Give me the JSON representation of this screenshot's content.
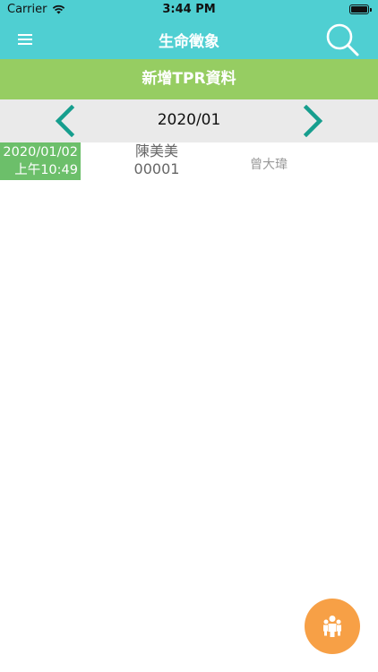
{
  "status_bar": {
    "carrier": "Carrier",
    "time": "3:44 PM",
    "icons": [
      "wifi-icon",
      "battery-icon"
    ]
  },
  "nav": {
    "title": "生命徵象",
    "menu_icon": "hamburger-menu-icon",
    "search_icon": "search-icon"
  },
  "add_button": {
    "label": "新增TPR資料"
  },
  "month_nav": {
    "label": "2020/01",
    "prev_icon": "chevron-left-icon",
    "next_icon": "chevron-right-icon"
  },
  "records": [
    {
      "date": "2020/01/02",
      "time": "上午10:49",
      "patient_name": "陳美美",
      "patient_id": "00001",
      "nurse": "曾大瑋"
    }
  ],
  "fab": {
    "icon": "people-group-icon"
  },
  "colors": {
    "nav_teal": "#4FCFD2",
    "add_green": "#96CD62",
    "date_green": "#6CBF6A",
    "arrow_teal": "#169E8E",
    "fab_orange": "#F7A046"
  }
}
